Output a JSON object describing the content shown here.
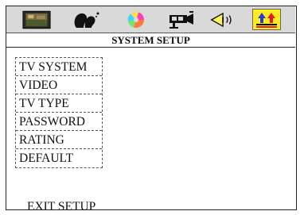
{
  "toolbar": {
    "items": [
      {
        "icon": "tv-screen-icon",
        "active": false
      },
      {
        "icon": "language-faces-icon",
        "active": false
      },
      {
        "icon": "audio-disc-icon",
        "active": false
      },
      {
        "icon": "video-camera-icon",
        "active": false
      },
      {
        "icon": "speaker-icon",
        "active": false
      },
      {
        "icon": "system-setup-icon",
        "active": true
      }
    ]
  },
  "page": {
    "title": "SYSTEM SETUP"
  },
  "menu": {
    "items": [
      {
        "label": "TV SYSTEM"
      },
      {
        "label": "VIDEO"
      },
      {
        "label": "TV TYPE"
      },
      {
        "label": "PASSWORD"
      },
      {
        "label": "RATING"
      },
      {
        "label": "DEFAULT"
      }
    ]
  },
  "exit": {
    "label": "EXIT SETUP"
  },
  "colors": {
    "toolbar_bg": "#d9d9d9",
    "active_tab_bg": "#ffec1f",
    "text": "#111111"
  }
}
